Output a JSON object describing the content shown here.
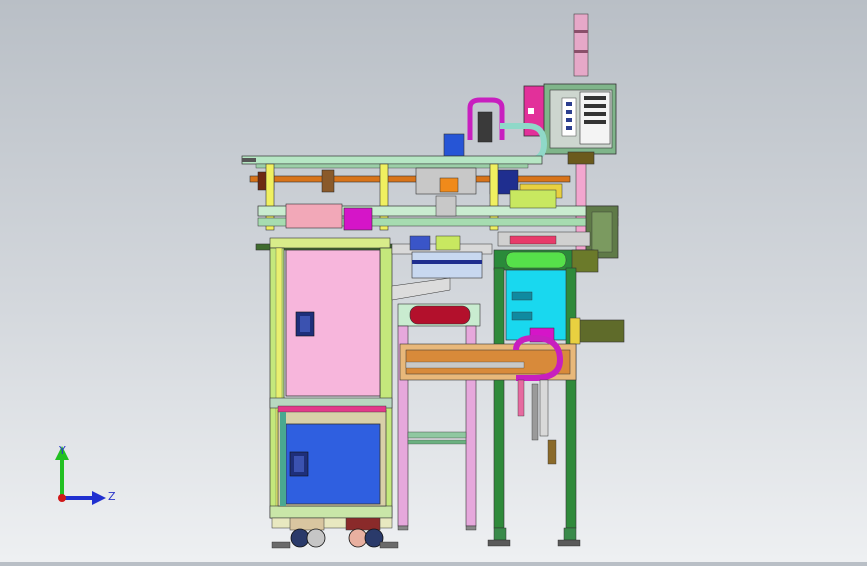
{
  "viewport": {
    "background_top": "#b9bfc6",
    "background_bottom": "#eef0f2"
  },
  "triad": {
    "y_label": "Y",
    "z_label": "Z",
    "y_color": "#22c022",
    "z_color": "#2030d0",
    "x_color": "#d01818"
  },
  "palette": {
    "frame_green": "#b9e68a",
    "frame_yellow": "#f0f060",
    "pink_panel": "#f7b6dc",
    "blue_panel": "#2f5fe0",
    "cyan_block": "#19d8ef",
    "magenta": "#d515c8",
    "red_roller": "#b3102c",
    "orange_rail": "#e08a20",
    "dark_olive": "#5f6b2a",
    "navy_cap": "#1f2e8f"
  }
}
